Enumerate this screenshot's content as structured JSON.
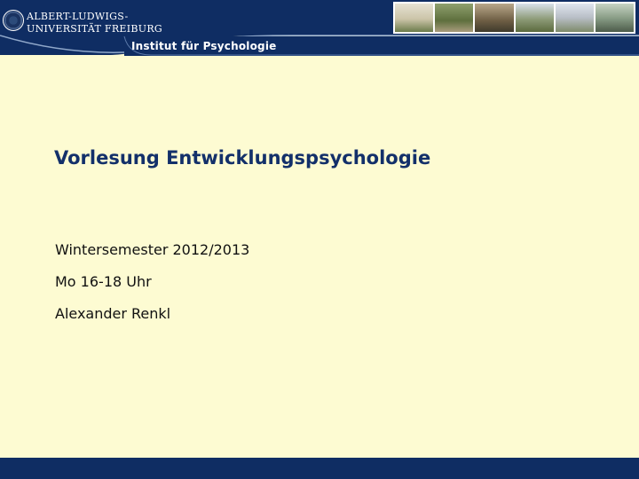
{
  "header": {
    "logo_line_1": "ALBERT-LUDWIGS-",
    "logo_line_2": "UNIVERSITÄT FREIBURG",
    "institute": "Institut für Psychologie",
    "photos": [
      "campus-building",
      "seminar-room",
      "classroom",
      "green-building",
      "modern-building",
      "lecture-room"
    ]
  },
  "slide": {
    "title": "Vorlesung Entwicklungspsychologie",
    "semester": "Wintersemester 2012/2013",
    "time": "Mo 16-18 Uhr",
    "lecturer": "Alexander Renkl"
  },
  "colors": {
    "background": "#fdfbd2",
    "header_blue": "#0f2d63",
    "title_blue": "#13306a"
  }
}
